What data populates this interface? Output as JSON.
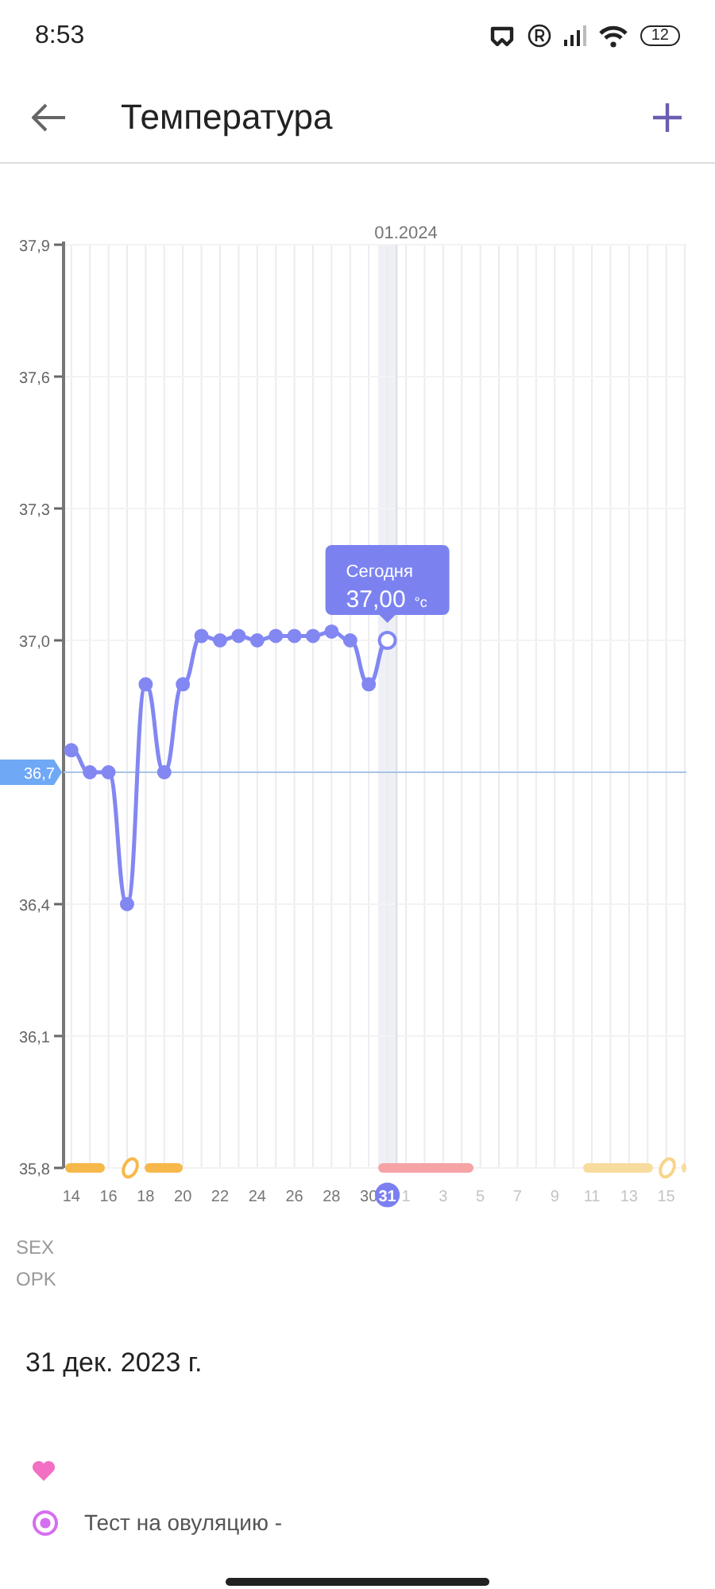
{
  "status_bar": {
    "time": "8:53",
    "battery": "12"
  },
  "toolbar": {
    "title": "Температура"
  },
  "month_label": "01.2024",
  "tooltip": {
    "title": "Сегодня",
    "value": "37,00",
    "unit": "°c"
  },
  "chart_data": {
    "type": "line",
    "grid": true,
    "x": [
      "2023-12-14",
      "2023-12-15",
      "2023-12-16",
      "2023-12-17",
      "2023-12-18",
      "2023-12-19",
      "2023-12-20",
      "2023-12-21",
      "2023-12-22",
      "2023-12-23",
      "2023-12-24",
      "2023-12-25",
      "2023-12-26",
      "2023-12-27",
      "2023-12-28",
      "2023-12-29",
      "2023-12-30",
      "2023-12-31"
    ],
    "series": [
      {
        "color": "#8287f2",
        "marker": "circle",
        "values": [
          36.75,
          36.7,
          36.7,
          36.4,
          36.9,
          36.7,
          36.9,
          37.01,
          37.0,
          37.01,
          37.0,
          37.01,
          37.01,
          37.01,
          37.02,
          37.0,
          36.9,
          37.0
        ]
      }
    ],
    "xlim": [
      "2023-12-13T14:00",
      "2024-01-16T02:00"
    ],
    "ylim": [
      35.8,
      37.9
    ],
    "yticks": [
      {
        "value": 37.9,
        "label": "37,9"
      },
      {
        "value": 37.6,
        "label": "37,6"
      },
      {
        "value": 37.3,
        "label": "37,3"
      },
      {
        "value": 37.0,
        "label": "37,0"
      },
      {
        "value": 36.4,
        "label": "36,4"
      },
      {
        "value": 36.1,
        "label": "36,1"
      },
      {
        "value": 35.8,
        "label": "35,8"
      }
    ],
    "xticks": [
      {
        "value": "2023-12-14",
        "label": "14"
      },
      {
        "value": "2023-12-16",
        "label": "16"
      },
      {
        "value": "2023-12-18",
        "label": "18"
      },
      {
        "value": "2023-12-20",
        "label": "20"
      },
      {
        "value": "2023-12-22",
        "label": "22"
      },
      {
        "value": "2023-12-24",
        "label": "24"
      },
      {
        "value": "2023-12-26",
        "label": "26"
      },
      {
        "value": "2023-12-28",
        "label": "28"
      },
      {
        "value": "2023-12-30",
        "label": "30"
      },
      {
        "value": "2023-12-31",
        "label": "31"
      },
      {
        "value": "2024-01-01",
        "label": "1"
      },
      {
        "value": "2024-01-03",
        "label": "3"
      },
      {
        "value": "2024-01-05",
        "label": "5"
      },
      {
        "value": "2024-01-07",
        "label": "7"
      },
      {
        "value": "2024-01-09",
        "label": "9"
      },
      {
        "value": "2024-01-11",
        "label": "11"
      },
      {
        "value": "2024-01-13",
        "label": "13"
      },
      {
        "value": "2024-01-15",
        "label": "15"
      }
    ],
    "ref_lines": [
      {
        "axis": "y",
        "value": 36.7,
        "label": "36,7",
        "color": "#a9c4e4"
      },
      {
        "axis": "x",
        "value": "2023-12-31T12:00",
        "color": "#dcdce4"
      }
    ],
    "bands": [
      {
        "axis": "x",
        "from": "2023-12-30T12:00",
        "to": "2023-12-31T12:00",
        "color": "#eef0f6"
      }
    ]
  },
  "legend_rows": [
    "SEX",
    "OPK"
  ],
  "day": {
    "date": "31 дек. 2023 г.",
    "entries": [
      {
        "kind": "sex",
        "color": "#f26fc4"
      },
      {
        "kind": "ovulation_test",
        "color": "#d66ef0",
        "label": "Тест на овуляцию -"
      }
    ]
  }
}
